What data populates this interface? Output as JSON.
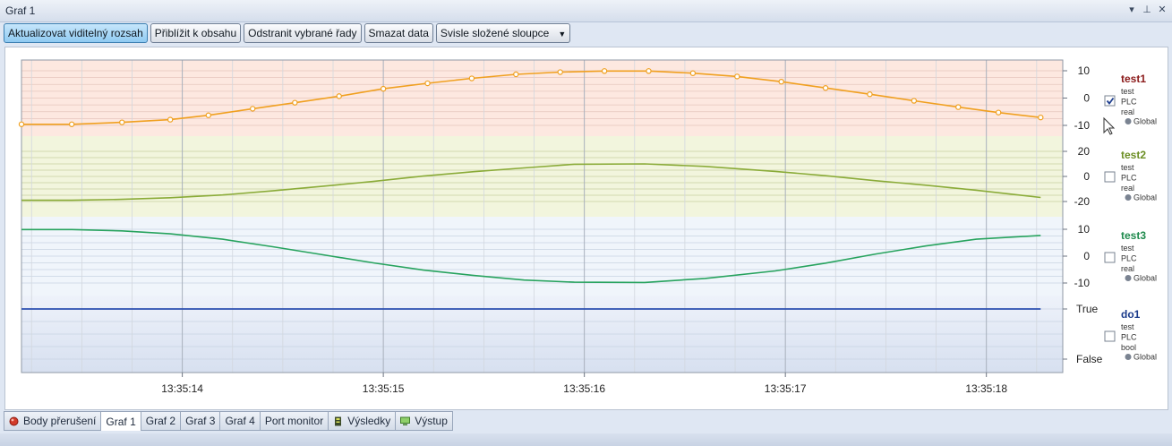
{
  "window": {
    "title": "Graf 1",
    "pin_icon": "pin-icon",
    "menu_icon": "dropdown-icon",
    "close_icon": "close-icon"
  },
  "toolbar": {
    "buttons": [
      {
        "label": "Aktualizovat viditelný rozsah",
        "active": true
      },
      {
        "label": "Přiblížit k obsahu",
        "active": false
      },
      {
        "label": "Odstranit vybrané řady",
        "active": false
      },
      {
        "label": "Smazat data",
        "active": false
      }
    ],
    "dropdown": {
      "label": "Svisle složené sloupce"
    }
  },
  "chart_data": {
    "type": "line",
    "x": [
      "13:35:13.20",
      "13:35:13.45",
      "13:35:13.70",
      "13:35:13.95",
      "13:35:14.20",
      "13:35:14.45",
      "13:35:14.70",
      "13:35:14.95",
      "13:35:15.20",
      "13:35:15.45",
      "13:35:15.70",
      "13:35:15.95",
      "13:35:16.20",
      "13:35:16.45",
      "13:35:16.70",
      "13:35:16.95",
      "13:35:17.20",
      "13:35:17.45",
      "13:35:17.70",
      "13:35:17.95",
      "13:35:18.20",
      "13:35:18.45"
    ],
    "xlim": [
      13.2,
      18.38
    ],
    "x_ticks": [
      {
        "label": "13:35:14",
        "value": 14
      },
      {
        "label": "13:35:15",
        "value": 15
      },
      {
        "label": "13:35:16",
        "value": 16
      },
      {
        "label": "13:35:17",
        "value": 17
      },
      {
        "label": "13:35:18",
        "value": 18
      }
    ],
    "grid": true,
    "legend_position": "right",
    "series": [
      {
        "name": "test1",
        "lines": [
          "test",
          "PLC",
          "real"
        ],
        "scope": "Global",
        "color": "#f0a020",
        "name_color": "#8b1a1a",
        "band_color": "#fde8e0",
        "checked": true,
        "ylim": [
          -10,
          10
        ],
        "yticks": [
          "10",
          "0",
          "-10"
        ],
        "markers": true,
        "x": [
          13.2,
          13.45,
          13.7,
          13.94,
          14.13,
          14.35,
          14.56,
          14.78,
          15.0,
          15.22,
          15.44,
          15.66,
          15.88,
          16.1,
          16.32,
          16.54,
          16.76,
          16.98,
          17.2,
          17.42,
          17.64,
          17.86,
          18.06,
          18.27
        ],
        "values": [
          -9.6,
          -9.6,
          -8.9,
          -7.9,
          -6.3,
          -3.9,
          -1.7,
          0.7,
          3.4,
          5.4,
          7.2,
          8.7,
          9.5,
          9.9,
          9.9,
          9.1,
          7.9,
          6.0,
          3.7,
          1.4,
          -1.0,
          -3.3,
          -5.3,
          -7.1
        ]
      },
      {
        "name": "test2",
        "lines": [
          "test",
          "PLC",
          "real"
        ],
        "scope": "Global",
        "color": "#8aab38",
        "name_color": "#6b8e23",
        "band_color": "#f2f5dd",
        "checked": false,
        "ylim": [
          -20,
          20
        ],
        "yticks": [
          "20",
          "0",
          "-20"
        ],
        "markers": false,
        "x": [
          13.2,
          13.45,
          13.7,
          13.94,
          14.2,
          14.45,
          14.7,
          14.95,
          15.2,
          15.45,
          15.7,
          15.95,
          16.3,
          16.6,
          16.95,
          17.2,
          17.45,
          17.7,
          17.95,
          18.27
        ],
        "values": [
          -19.0,
          -19.0,
          -18.3,
          -17.0,
          -14.8,
          -11.5,
          -7.8,
          -4.0,
          0.3,
          3.8,
          6.8,
          9.7,
          10.0,
          8.0,
          4.0,
          0.6,
          -3.4,
          -7.0,
          -11.0,
          -16.8
        ]
      },
      {
        "name": "test3",
        "lines": [
          "test",
          "PLC",
          "real"
        ],
        "scope": "Global",
        "color": "#27a35e",
        "name_color": "#1e8a4c",
        "band_color": "#f0f5fb",
        "checked": false,
        "ylim": [
          -10,
          10
        ],
        "yticks": [
          "10",
          "0",
          "-10"
        ],
        "markers": false,
        "x": [
          13.2,
          13.45,
          13.7,
          13.94,
          14.2,
          14.45,
          14.7,
          14.95,
          15.2,
          15.45,
          15.7,
          15.95,
          16.3,
          16.6,
          16.95,
          17.2,
          17.45,
          17.7,
          17.95,
          18.27
        ],
        "values": [
          9.9,
          9.9,
          9.4,
          8.3,
          6.3,
          3.5,
          0.5,
          -2.5,
          -5.2,
          -7.2,
          -8.9,
          -9.7,
          -9.8,
          -8.3,
          -5.5,
          -2.6,
          0.8,
          3.8,
          6.3,
          7.7
        ]
      },
      {
        "name": "do1",
        "lines": [
          "test",
          "PLC",
          "bool"
        ],
        "scope": "Global",
        "color": "#2b4fb0",
        "name_color": "#1a3a8a",
        "band_color": "#dfe6f4",
        "checked": false,
        "ylim": [
          0,
          1
        ],
        "yticks": [
          "True",
          "False"
        ],
        "markers": false,
        "x": [
          13.2,
          18.27
        ],
        "values": [
          1,
          1
        ]
      }
    ]
  },
  "tabs": [
    {
      "label": "Body přerušení",
      "icon": "breakpoint-icon",
      "active": false
    },
    {
      "label": "Graf 1",
      "icon": "",
      "active": true
    },
    {
      "label": "Graf 2",
      "icon": "",
      "active": false
    },
    {
      "label": "Graf 3",
      "icon": "",
      "active": false
    },
    {
      "label": "Graf 4",
      "icon": "",
      "active": false
    },
    {
      "label": "Port monitor",
      "icon": "",
      "active": false
    },
    {
      "label": "Výsledky",
      "icon": "results-icon",
      "active": false
    },
    {
      "label": "Výstup",
      "icon": "output-icon",
      "active": false
    }
  ]
}
